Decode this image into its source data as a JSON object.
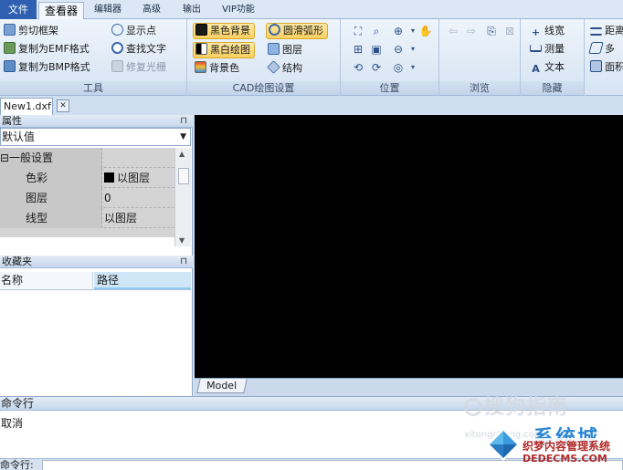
{
  "menubar": {
    "file": "文件",
    "tabs": [
      "查看器",
      "编辑器",
      "高级",
      "输出",
      "VIP功能"
    ],
    "active_tab": "查看器"
  },
  "ribbon": {
    "tools": {
      "label": "工具",
      "items": [
        "剪切框架",
        "复制为EMF格式",
        "复制为BMP格式",
        "显示点",
        "查找文字",
        "修复光栅"
      ]
    },
    "cad": {
      "label": "CAD绘图设置",
      "items": [
        "黑色背景",
        "黑白绘图",
        "背景色",
        "圆滑弧形",
        "图层",
        "结构"
      ]
    },
    "position": {
      "label": "位置"
    },
    "browse": {
      "label": "浏览"
    },
    "hide": {
      "label": "隐藏",
      "items": [
        "线宽",
        "测量",
        "文本"
      ]
    },
    "measure": {
      "items": [
        "距离",
        "多",
        "面积"
      ]
    }
  },
  "document": {
    "tab": "New1.dxf",
    "close": "✕"
  },
  "properties": {
    "title": "属性",
    "pin": "⊓",
    "dropdown_value": "默认值",
    "rows": [
      {
        "key": "⊟一般设置",
        "value": ""
      },
      {
        "key": "色彩",
        "value": "以图层"
      },
      {
        "key": "图层",
        "value": "0"
      },
      {
        "key": "线型",
        "value": "以图层"
      }
    ]
  },
  "favorites": {
    "title": "收藏夹",
    "pin": "⊓",
    "columns": [
      "名称",
      "路径"
    ]
  },
  "canvas": {
    "model_tab": "Model",
    "background": "#000000"
  },
  "command": {
    "title": "命令行",
    "output": "取消",
    "input_label": "命令行:",
    "input_value": ""
  },
  "watermarks": {
    "sogou": "搜狗指南",
    "site_big": "系统城",
    "site_sub": "织梦内容管理系统",
    "site_url": "DEDECMS.COM",
    "small": "xitongcheng.com"
  },
  "colors": {
    "accent": "#2e5fb0",
    "highlight": "#f9cf5e",
    "ribbon_bg": "#dbe7f4"
  }
}
